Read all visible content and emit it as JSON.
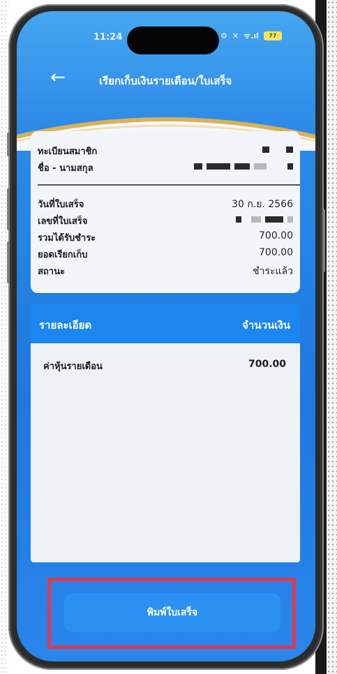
{
  "status_bar": {
    "time": "11:24",
    "signal_text": "ᯤ.ıl",
    "battery_level": "77"
  },
  "header": {
    "title": "เรียกเก็บเงินรายเดือน/ใบเสร็จ",
    "back_icon": "arrow-left-icon"
  },
  "member": {
    "registration_label": "ทะเบียนสมาชิก",
    "name_label": "ชื่อ - นามสกุล"
  },
  "receipt": {
    "date_label": "วันที่ใบเสร็จ",
    "date_value": "30 ก.ย. 2566",
    "number_label": "เลขที่ใบเสร็จ",
    "total_received_label": "รวมได้รับชำระ",
    "total_received_value": "700.00",
    "billed_label": "ยอดเรียกเก็บ",
    "billed_value": "700.00",
    "status_label": "สถานะ",
    "status_value": "ชำระแล้ว"
  },
  "details": {
    "col_item": "รายละเอียด",
    "col_amount": "จำนวนเงิน",
    "items": [
      {
        "label": "ค่าหุ้นรายเดือน",
        "amount": "700.00"
      }
    ]
  },
  "actions": {
    "print_label": "พิมพ์ใบเสร็จ"
  },
  "colors": {
    "primary": "#1b86f0",
    "highlight": "#e0394f",
    "gold": "#d8b25a"
  }
}
